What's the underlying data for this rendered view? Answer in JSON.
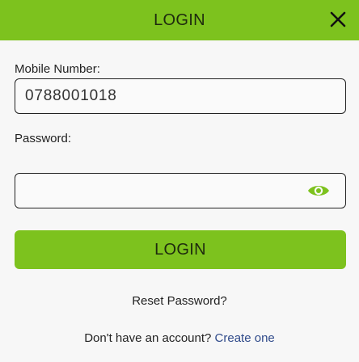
{
  "header": {
    "title": "LOGIN",
    "close_icon": "close-icon",
    "background": "#7dc21e"
  },
  "form": {
    "mobile_label": "Mobile Number:",
    "mobile_value": "0788001018",
    "password_label": "Password:",
    "password_value": "",
    "eye_icon": "eye-icon",
    "eye_color": "#7dc21e",
    "login_button": "LOGIN"
  },
  "footer": {
    "reset_link": "Reset Password?",
    "signup_prompt": "Don't have an account?",
    "create_link": "Create one"
  }
}
